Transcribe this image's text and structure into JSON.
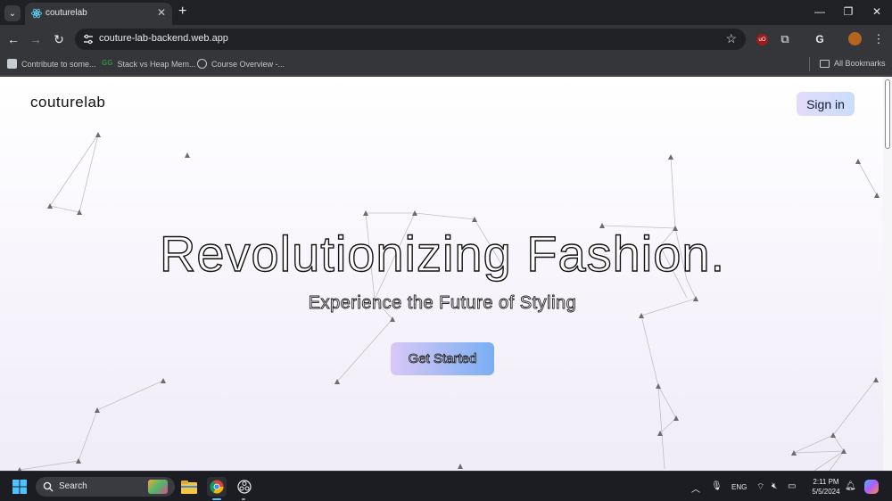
{
  "browser": {
    "tab": {
      "title": "couturelab"
    },
    "address": {
      "url": "couture-lab-backend.web.app"
    },
    "bookmarks": [
      {
        "label": "Contribute to some..."
      },
      {
        "label": "Stack vs Heap Mem..."
      },
      {
        "label": "Course Overview -..."
      }
    ],
    "all_bookmarks_label": "All Bookmarks"
  },
  "page": {
    "logo": "couturelab",
    "signin_label": "Sign in",
    "headline": "Revolutionizing Fashion.",
    "subheadline": "Experience the Future of Styling",
    "cta_label": "Get Started"
  },
  "taskbar": {
    "search_label": "Search",
    "lang": "ENG",
    "time": "2:11 PM",
    "date": "5/5/2024"
  },
  "colors": {
    "accent_gradient_start": "#e3dcfb",
    "accent_gradient_end": "#c9ddfa",
    "cta_gradient_start": "#d9c8f6",
    "cta_gradient_end": "#79aef3"
  }
}
